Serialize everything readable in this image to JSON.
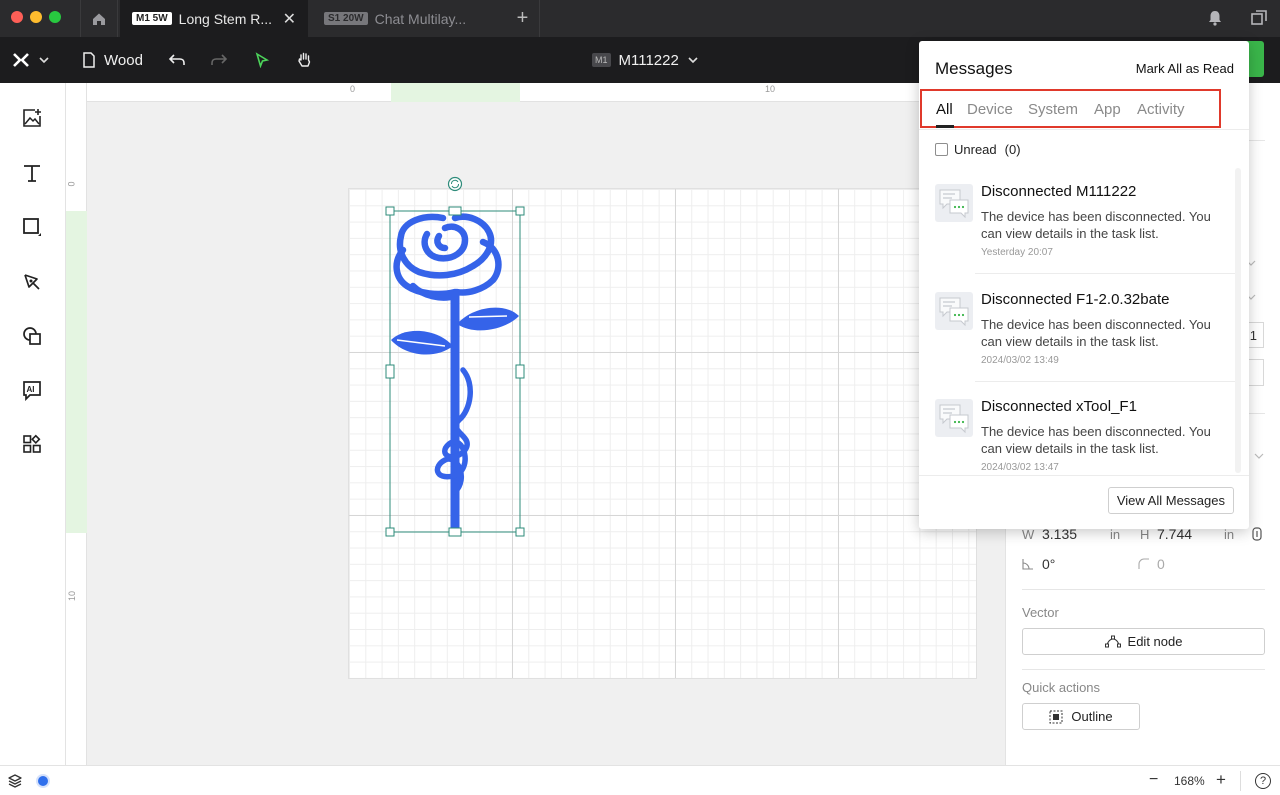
{
  "window": {
    "tabs": [
      {
        "badge": "M1 5W",
        "title": "Long Stem R...",
        "active": true
      },
      {
        "badge": "S1 20W",
        "title": "Chat Multilay...",
        "active": false
      }
    ]
  },
  "toolbar": {
    "project_name": "Wood",
    "device_badge": "M1",
    "device_name": "M111222"
  },
  "canvas": {
    "ruler_top_marks": [
      "0",
      "10"
    ],
    "ruler_left_marks": [
      "0",
      "10"
    ]
  },
  "right_panel": {
    "w_label": "W",
    "w_value": "3.135",
    "w_unit": "in",
    "h_label": "H",
    "h_value": "7.744",
    "h_unit": "in",
    "rotation": "0°",
    "corner": "0",
    "partial_value": "1",
    "vector_label": "Vector",
    "edit_node_label": "Edit node",
    "quick_actions_label": "Quick actions",
    "outline_label": "Outline"
  },
  "statusbar": {
    "zoom": "168%",
    "zoom_minus": "−",
    "zoom_plus": "+",
    "help": "?"
  },
  "messages": {
    "title": "Messages",
    "mark_all_read": "Mark All as Read",
    "tabs": [
      "All",
      "Device",
      "System",
      "App",
      "Activity"
    ],
    "active_tab": "All",
    "unread_label": "Unread",
    "unread_count": "(0)",
    "items": [
      {
        "title": "Disconnected M111222",
        "body": "The device has been disconnected. You can view details in the task list.",
        "time": "Yesterday 20:07"
      },
      {
        "title": "Disconnected F1-2.0.32bate",
        "body": "The device has been disconnected. You can view details in the task list.",
        "time": "2024/03/02 13:49"
      },
      {
        "title": "Disconnected xTool_F1",
        "body": "The device has been disconnected. You can view details in the task list.",
        "time": "2024/03/02 13:47"
      }
    ],
    "view_all": "View All Messages"
  },
  "colors": {
    "design_blue": "#3563e9",
    "selection": "#2e8b7a",
    "highlight_red": "#e0392b",
    "accent_green": "#3ab54a"
  }
}
